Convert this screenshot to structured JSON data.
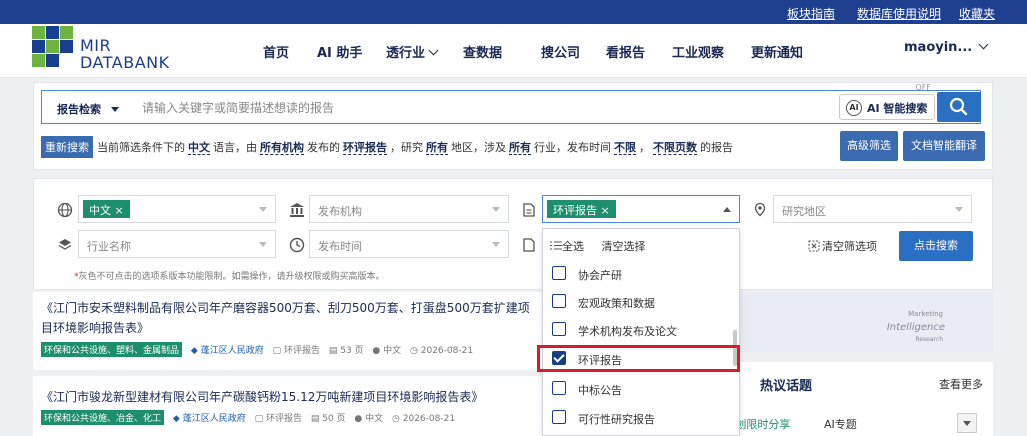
{
  "top_links": [
    "板块指南",
    "数据库使用说明",
    "收藏夹"
  ],
  "logo": {
    "line1": "MIR",
    "line2": "DATABANK"
  },
  "nav": {
    "items": [
      "首页",
      "AI 助手",
      "透行业",
      "查数据",
      "搜公司",
      "看报告",
      "工业观察",
      "更新通知"
    ],
    "user": "maoyin..."
  },
  "search": {
    "type_label": "报告检索",
    "placeholder": "请输入关键字或简要描述想读的报告",
    "ai_label": "AI 智能搜索",
    "ai_state": "OFF",
    "ai_icon": "AI"
  },
  "filter_summary": {
    "reset_label": "重新搜索",
    "t1": "当前筛选条件下的",
    "language": "中文",
    "t2": "语言，由",
    "org": "所有机构",
    "t3": "发布的",
    "report_type": "环评报告",
    "t4": "，研究",
    "region": "所有",
    "t5": "地区，涉及",
    "industry": "所有",
    "t6": "行业，发布时间",
    "time": "不限",
    "comma": "，",
    "pages": "不限页数",
    "t7": "的报告"
  },
  "buttons": {
    "advanced": "高级筛选",
    "translate": "文档智能翻译",
    "clear_filters": "清空筛选项",
    "search": "点击搜索"
  },
  "filters": {
    "language_tag": "中文 ×",
    "org_placeholder": "发布机构",
    "type_tag": "环评报告 ×",
    "region_placeholder": "研究地区",
    "industry_placeholder": "行业名称",
    "time_placeholder": "发布时间"
  },
  "note": {
    "star": "*",
    "text": "灰色不可点击的选项系版本功能限制。如需操作，请升级权限或购买高版本。"
  },
  "dropdown": {
    "select_all": "全选",
    "clear": "清空选择",
    "items": [
      {
        "label": "协会产研",
        "checked": false
      },
      {
        "label": "宏观政策和数据",
        "checked": false
      },
      {
        "label": "学术机构发布及论文",
        "checked": false
      },
      {
        "label": "环评报告",
        "checked": true
      },
      {
        "label": "中标公告",
        "checked": false
      },
      {
        "label": "可行性研究报告",
        "checked": false
      }
    ]
  },
  "results": [
    {
      "title": "《江门市安禾塑料制品有限公司年产磨容器500万套、刮刀500万套、打蛋盘500万套扩建项目环境影响报告表》",
      "category": "环保和公共设施、塑料、金属制品",
      "publisher": "蓬江区人民政府",
      "type": "环评报告",
      "pages": "53 页",
      "lang": "中文",
      "date": "2026-08-21"
    },
    {
      "title": "《江门市骏龙新型建材有限公司年产碳酸钙粉15.12万吨新建项目环境影响报告表》",
      "category": "环保和公共设施、冶金、化工",
      "publisher": "蓬江区人民政府",
      "type": "环评报告",
      "pages": "50 页",
      "lang": "中文",
      "date": "2026-08-21"
    }
  ],
  "banner": {
    "t1": "Marketing",
    "t2": "Intelligence",
    "t3": "Research"
  },
  "side": {
    "title": "热议话题",
    "more": "查看更多",
    "tab1": "MIR原创限时分享",
    "tab2": "AI专题"
  },
  "colors": {
    "topbar": "#1f3f8f",
    "accent": "#2a6fc2",
    "tag": "#1e8f6e",
    "highlight": "#d21f2a"
  }
}
